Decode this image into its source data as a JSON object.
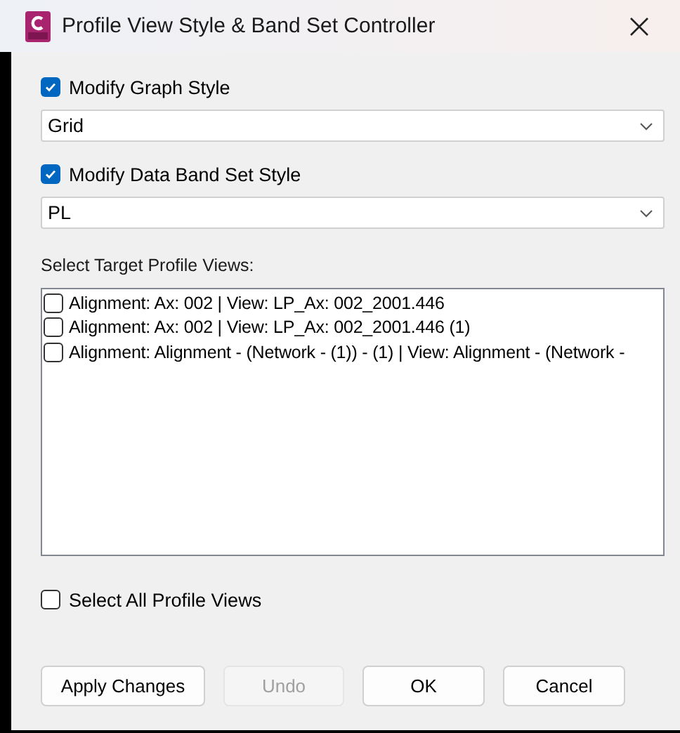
{
  "window": {
    "title": "Profile View Style & Band Set Controller"
  },
  "graph_style": {
    "label": "Modify Graph Style",
    "checked": true,
    "value": "Grid"
  },
  "band_set_style": {
    "label": "Modify Data Band Set Style",
    "checked": true,
    "value": "PL"
  },
  "target_views": {
    "label": "Select Target Profile Views:",
    "items": [
      {
        "label": "Alignment: Ax: 002 | View: LP_Ax: 002_2001.446",
        "checked": false
      },
      {
        "label": "Alignment: Ax: 002 | View: LP_Ax: 002_2001.446 (1)",
        "checked": false
      },
      {
        "label": "Alignment: Alignment - (Network - (1)) - (1) | View: Alignment - (Network -",
        "checked": false
      }
    ]
  },
  "select_all": {
    "label": "Select All Profile Views",
    "checked": false
  },
  "buttons": [
    {
      "label": "Apply Changes",
      "disabled": false
    },
    {
      "label": "Undo",
      "disabled": true
    },
    {
      "label": "OK",
      "disabled": false
    },
    {
      "label": "Cancel",
      "disabled": false
    }
  ]
}
